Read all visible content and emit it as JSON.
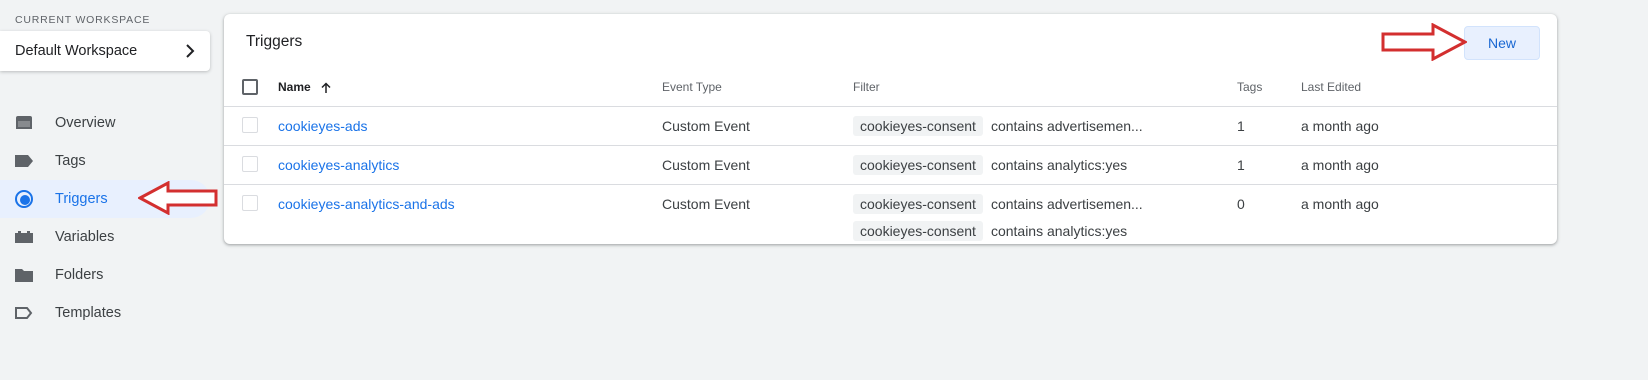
{
  "workspace": {
    "label": "CURRENT WORKSPACE",
    "name": "Default Workspace"
  },
  "nav": {
    "items": [
      {
        "label": "Overview",
        "icon": "overview-icon",
        "active": false
      },
      {
        "label": "Tags",
        "icon": "tag-icon",
        "active": false
      },
      {
        "label": "Triggers",
        "icon": "trigger-icon",
        "active": true
      },
      {
        "label": "Variables",
        "icon": "variables-icon",
        "active": false
      },
      {
        "label": "Folders",
        "icon": "folder-icon",
        "active": false
      },
      {
        "label": "Templates",
        "icon": "template-icon",
        "active": false
      }
    ]
  },
  "main": {
    "title": "Triggers",
    "new_label": "New",
    "columns": {
      "name": "Name",
      "event_type": "Event Type",
      "filter": "Filter",
      "tags": "Tags",
      "last_edited": "Last Edited"
    },
    "rows": [
      {
        "name": "cookieyes-ads",
        "event_type": "Custom Event",
        "filters": [
          {
            "variable": "cookieyes-consent",
            "condition": "contains advertisemen..."
          }
        ],
        "tags": "1",
        "last_edited": "a month ago"
      },
      {
        "name": "cookieyes-analytics",
        "event_type": "Custom Event",
        "filters": [
          {
            "variable": "cookieyes-consent",
            "condition": "contains analytics:yes"
          }
        ],
        "tags": "1",
        "last_edited": "a month ago"
      },
      {
        "name": "cookieyes-analytics-and-ads",
        "event_type": "Custom Event",
        "filters": [
          {
            "variable": "cookieyes-consent",
            "condition": "contains advertisemen..."
          },
          {
            "variable": "cookieyes-consent",
            "condition": "contains analytics:yes"
          }
        ],
        "tags": "0",
        "last_edited": "a month ago"
      }
    ]
  },
  "colors": {
    "accent": "#1a73e8",
    "active_bg": "#e8f0fe",
    "annotation_arrow": "#d32f2f",
    "page_bg": "#f1f3f4"
  }
}
